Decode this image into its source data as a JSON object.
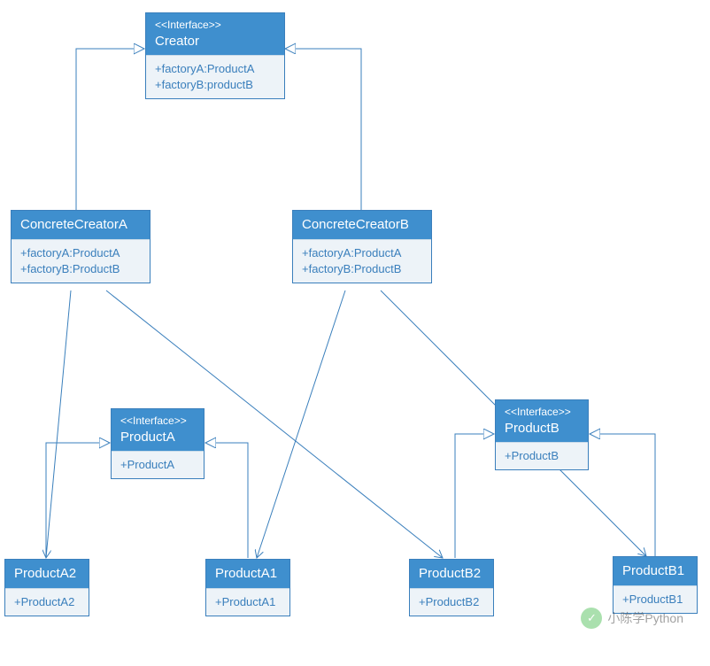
{
  "creator": {
    "stereo": "<<Interface>>",
    "title": "Creator",
    "m1": "+factoryA:ProductA",
    "m2": "+factoryB:productB"
  },
  "concreteA": {
    "title": "ConcreteCreatorA",
    "m1": "+factoryA:ProductA",
    "m2": "+factoryB:ProductB"
  },
  "concreteB": {
    "title": "ConcreteCreatorB",
    "m1": "+factoryA:ProductA",
    "m2": "+factoryB:ProductB"
  },
  "productA": {
    "stereo": "<<Interface>>",
    "title": "ProductA",
    "m1": "+ProductA"
  },
  "productB": {
    "stereo": "<<Interface>>",
    "title": "ProductB",
    "m1": "+ProductB"
  },
  "pA1": {
    "title": "ProductA1",
    "m1": "+ProductA1"
  },
  "pA2": {
    "title": "ProductA2",
    "m1": "+ProductA2"
  },
  "pB1": {
    "title": "ProductB1",
    "m1": "+ProductB1"
  },
  "pB2": {
    "title": "ProductB2",
    "m1": "+ProductB2"
  },
  "watermark": "小陈学Python"
}
